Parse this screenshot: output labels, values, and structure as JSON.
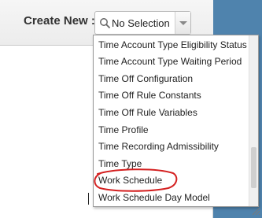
{
  "header": {
    "create_label": "Create New :",
    "select_value": "No Selection"
  },
  "dropdown": {
    "items": [
      "Time Account Type Eligibility Status",
      "Time Account Type Waiting Period",
      "Time Off Configuration",
      "Time Off Rule Constants",
      "Time Off Rule Variables",
      "Time Profile",
      "Time Recording Admissibility",
      "Time Type",
      "Work Schedule",
      "Work Schedule Day Model"
    ],
    "highlighted_item": "Work Schedule"
  },
  "colors": {
    "background_accent": "#4f83ad",
    "annotation": "#d42020"
  }
}
